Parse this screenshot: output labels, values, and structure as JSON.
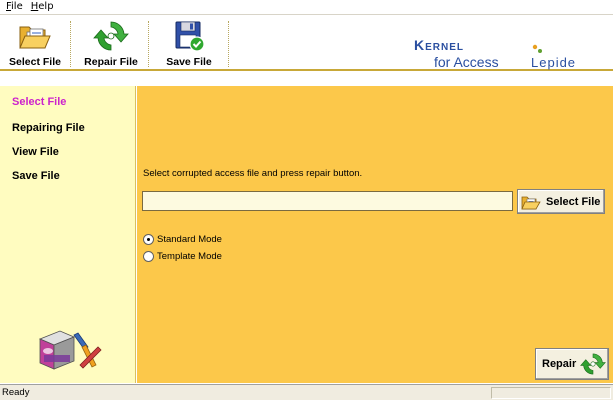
{
  "menu": {
    "file": "File",
    "help": "Help"
  },
  "toolbar": {
    "select_file": "Select File",
    "repair_file": "Repair File",
    "save_file": "Save File"
  },
  "brand": {
    "kernel": "Kernel",
    "for_access": "for Access",
    "lepide": "Lepide"
  },
  "sidebar": {
    "items": [
      {
        "label": "Select File",
        "active": true
      },
      {
        "label": "Repairing File",
        "active": false
      },
      {
        "label": "View File",
        "active": false
      },
      {
        "label": "Save File",
        "active": false
      }
    ]
  },
  "main": {
    "instruction": "Select corrupted access file and press repair button.",
    "file_path_value": "",
    "select_file_button": "Select File",
    "modes": [
      {
        "label": "Standard Mode",
        "selected": true
      },
      {
        "label": "Template Mode",
        "selected": false
      }
    ],
    "repair_button": "Repair"
  },
  "status": {
    "text": "Ready"
  },
  "colors": {
    "main_bg": "#fcc84a",
    "sidebar_bg": "#fffcc0",
    "active_nav": "#cc22cc",
    "brand_blue": "#2a4fa0"
  },
  "icons": {
    "select_file": "folder-open-icon",
    "repair_file": "recycle-arrows-icon",
    "save_file": "floppy-check-icon",
    "repair": "recycle-arrows-icon",
    "side_logo": "access-box-tools-icon"
  }
}
